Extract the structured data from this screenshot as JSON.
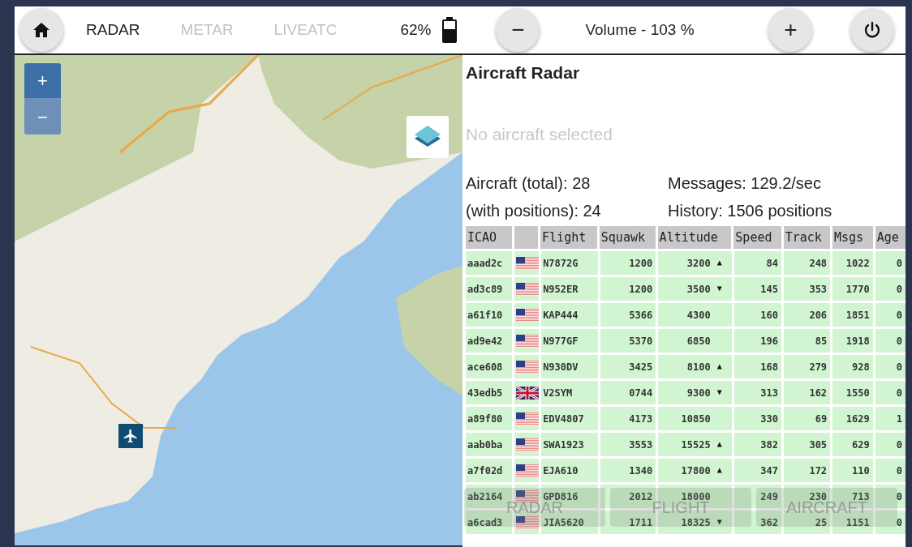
{
  "top_bar": {
    "tabs": [
      {
        "label": "RADAR",
        "selected": true
      },
      {
        "label": "METAR",
        "selected": false
      },
      {
        "label": "LIVEATC",
        "selected": false
      }
    ],
    "battery": "62%",
    "battery_icon": {
      "level": 0.62
    },
    "volume": "Volume - 103 %",
    "volume_down": "−",
    "volume_up": "+"
  },
  "map": {
    "zoom_in": "+",
    "zoom_out": "−"
  },
  "panel": {
    "title": "Aircraft Radar",
    "selection": "No aircraft selected",
    "stats": [
      "Aircraft (total): 28",
      "Messages: 129.2/sec",
      "(with positions): 24",
      "History: 1506 positions"
    ]
  },
  "table": {
    "columns": [
      "ICAO",
      "",
      "Flight",
      "Squawk",
      "Altitude",
      "Speed",
      "Track",
      "Msgs",
      "Age"
    ],
    "rows": [
      {
        "icao": "aaad2c",
        "kind": "us",
        "flight": "N7872G",
        "squawk": "1200",
        "altitude": "3200",
        "trend": "▲",
        "speed": "84",
        "track": "248",
        "msgs": "1022",
        "age": "0"
      },
      {
        "icao": "ad3c89",
        "kind": "us",
        "flight": "N952ER",
        "squawk": "1200",
        "altitude": "3500",
        "trend": "▼",
        "speed": "145",
        "track": "353",
        "msgs": "1770",
        "age": "0"
      },
      {
        "icao": "a61f10",
        "kind": "us",
        "flight": "KAP444",
        "squawk": "5366",
        "altitude": "4300",
        "trend": "",
        "speed": "160",
        "track": "206",
        "msgs": "1851",
        "age": "0"
      },
      {
        "icao": "ad9e42",
        "kind": "us",
        "flight": "N977GF",
        "squawk": "5370",
        "altitude": "6850",
        "trend": "",
        "speed": "196",
        "track": "85",
        "msgs": "1918",
        "age": "0"
      },
      {
        "icao": "ace608",
        "kind": "us",
        "flight": "N930DV",
        "squawk": "3425",
        "altitude": "8100",
        "trend": "▲",
        "speed": "168",
        "track": "279",
        "msgs": "928",
        "age": "0"
      },
      {
        "icao": "43edb5",
        "kind": "gb",
        "flight": "V2SYM",
        "squawk": "0744",
        "altitude": "9300",
        "trend": "▼",
        "speed": "313",
        "track": "162",
        "msgs": "1550",
        "age": "0"
      },
      {
        "icao": "a89f80",
        "kind": "us",
        "flight": "EDV4807",
        "squawk": "4173",
        "altitude": "10850",
        "trend": "",
        "speed": "330",
        "track": "69",
        "msgs": "1629",
        "age": "1"
      },
      {
        "icao": "aab0ba",
        "kind": "us",
        "flight": "SWA1923",
        "squawk": "3553",
        "altitude": "15525",
        "trend": "▲",
        "speed": "382",
        "track": "305",
        "msgs": "629",
        "age": "0"
      },
      {
        "icao": "a7f02d",
        "kind": "us",
        "flight": "EJA610",
        "squawk": "1340",
        "altitude": "17800",
        "trend": "▲",
        "speed": "347",
        "track": "172",
        "msgs": "110",
        "age": "0"
      },
      {
        "icao": "ab2164",
        "kind": "us",
        "flight": "GPD816",
        "squawk": "2012",
        "altitude": "18000",
        "trend": "",
        "speed": "249",
        "track": "230",
        "msgs": "713",
        "age": "0"
      },
      {
        "icao": "a6cad3",
        "kind": "us",
        "flight": "JIA5620",
        "squawk": "1711",
        "altitude": "18325",
        "trend": "▼",
        "speed": "362",
        "track": "25",
        "msgs": "1151",
        "age": "0"
      }
    ]
  },
  "bottom_tabs": [
    "RADAR",
    "FLIGHT",
    "AIRCRAFT"
  ]
}
